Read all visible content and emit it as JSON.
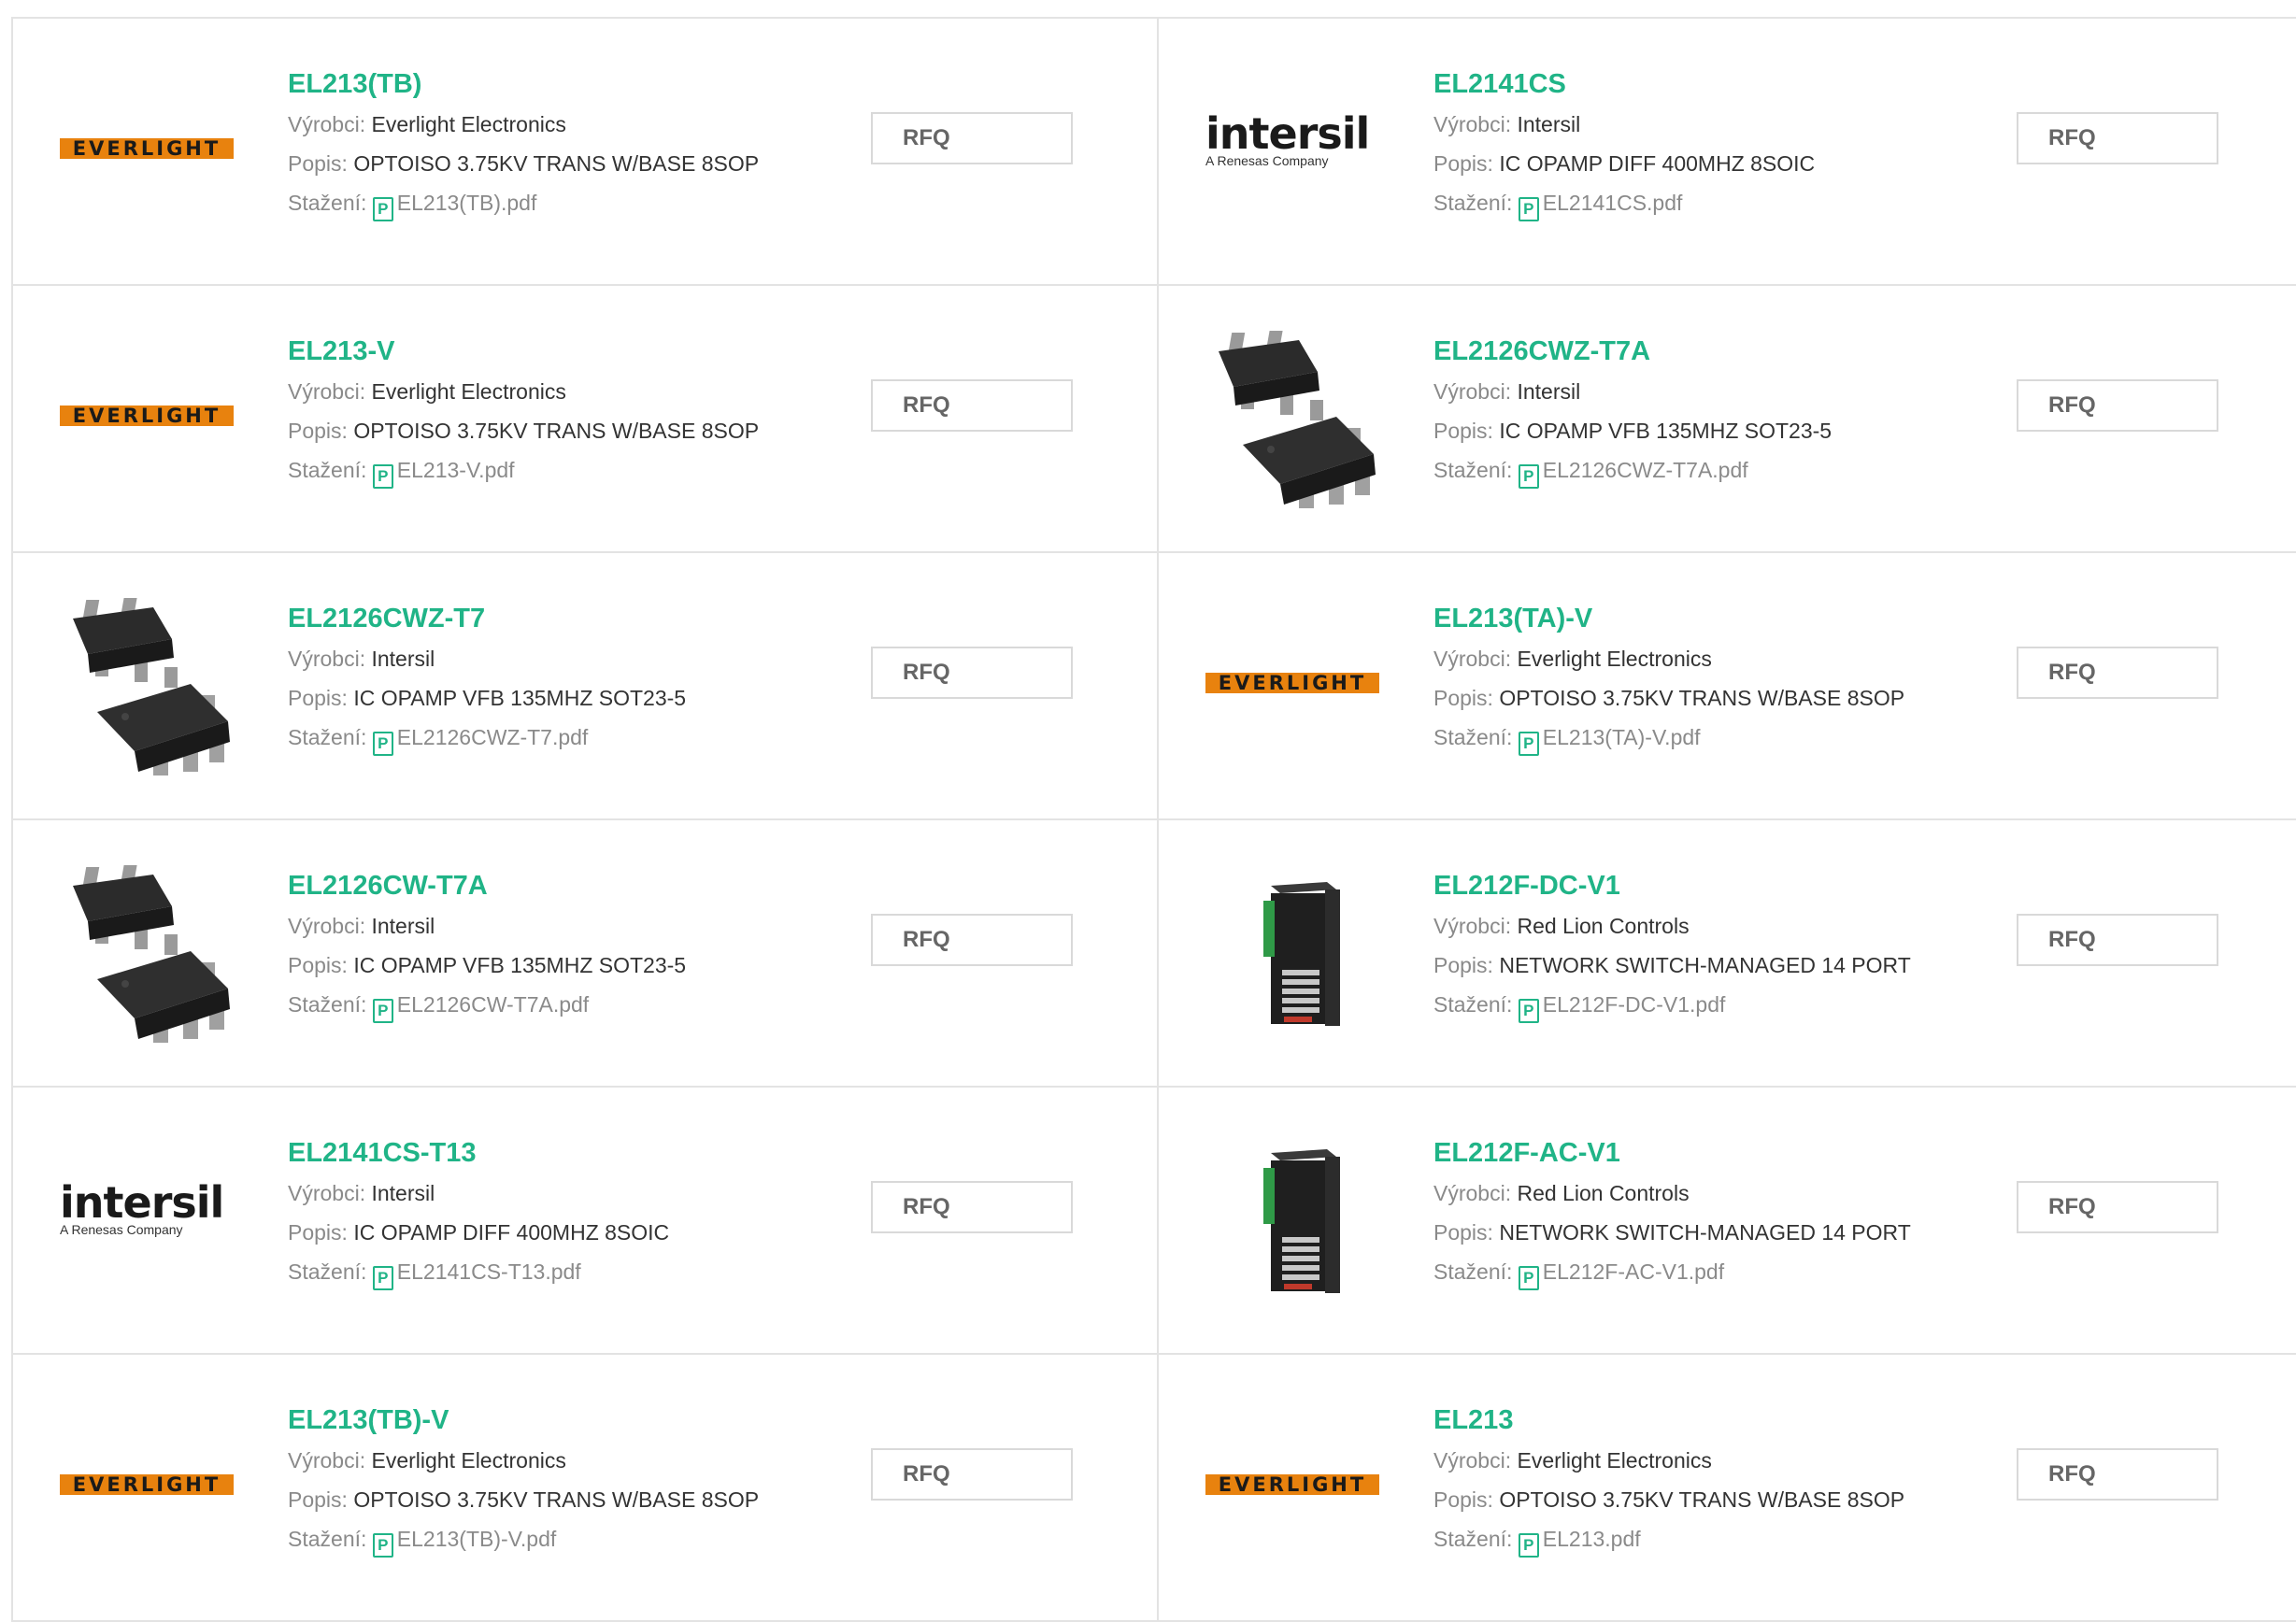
{
  "labels": {
    "manufacturer": "Výrobci:",
    "description": "Popis:",
    "download": "Stažení:",
    "rfq": "RFQ"
  },
  "brands": {
    "everlight": "EVERLIGHT",
    "intersil": "intersil",
    "intersil_sub": "A Renesas Company"
  },
  "colors": {
    "accent": "#20b487",
    "everlight_orange": "#e8820e",
    "border": "#e3e3e3"
  },
  "products": [
    {
      "pn": "EL213(TB)",
      "manufacturer": "Everlight Electronics",
      "description": "OPTOISO 3.75KV TRANS W/BASE 8SOP",
      "file": "EL213(TB).pdf",
      "image": "everlight-logo"
    },
    {
      "pn": "EL2141CS",
      "manufacturer": "Intersil",
      "description": "IC OPAMP DIFF 400MHZ 8SOIC",
      "file": "EL2141CS.pdf",
      "image": "intersil-logo"
    },
    {
      "pn": "EL213-V",
      "manufacturer": "Everlight Electronics",
      "description": "OPTOISO 3.75KV TRANS W/BASE 8SOP",
      "file": "EL213-V.pdf",
      "image": "everlight-logo"
    },
    {
      "pn": "EL2126CWZ-T7A",
      "manufacturer": "Intersil",
      "description": "IC OPAMP VFB 135MHZ SOT23-5",
      "file": "EL2126CWZ-T7A.pdf",
      "image": "sot23-chip"
    },
    {
      "pn": "EL2126CWZ-T7",
      "manufacturer": "Intersil",
      "description": "IC OPAMP VFB 135MHZ SOT23-5",
      "file": "EL2126CWZ-T7.pdf",
      "image": "sot23-chip"
    },
    {
      "pn": "EL213(TA)-V",
      "manufacturer": "Everlight Electronics",
      "description": "OPTOISO 3.75KV TRANS W/BASE 8SOP",
      "file": "EL213(TA)-V.pdf",
      "image": "everlight-logo"
    },
    {
      "pn": "EL2126CW-T7A",
      "manufacturer": "Intersil",
      "description": "IC OPAMP VFB 135MHZ SOT23-5",
      "file": "EL2126CW-T7A.pdf",
      "image": "sot23-chip"
    },
    {
      "pn": "EL212F-DC-V1",
      "manufacturer": "Red Lion Controls",
      "description": "NETWORK SWITCH-MANAGED 14 PORT",
      "file": "EL212F-DC-V1.pdf",
      "image": "network-switch"
    },
    {
      "pn": "EL2141CS-T13",
      "manufacturer": "Intersil",
      "description": "IC OPAMP DIFF 400MHZ 8SOIC",
      "file": "EL2141CS-T13.pdf",
      "image": "intersil-logo"
    },
    {
      "pn": "EL212F-AC-V1",
      "manufacturer": "Red Lion Controls",
      "description": "NETWORK SWITCH-MANAGED 14 PORT",
      "file": "EL212F-AC-V1.pdf",
      "image": "network-switch"
    },
    {
      "pn": "EL213(TB)-V",
      "manufacturer": "Everlight Electronics",
      "description": "OPTOISO 3.75KV TRANS W/BASE 8SOP",
      "file": "EL213(TB)-V.pdf",
      "image": "everlight-logo"
    },
    {
      "pn": "EL213",
      "manufacturer": "Everlight Electronics",
      "description": "OPTOISO 3.75KV TRANS W/BASE 8SOP",
      "file": "EL213.pdf",
      "image": "everlight-logo"
    }
  ]
}
